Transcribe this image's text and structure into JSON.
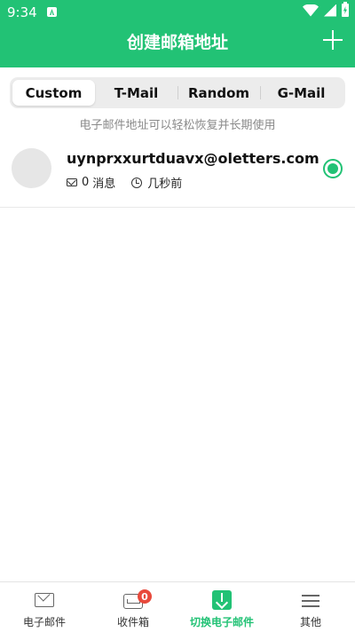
{
  "status_bar": {
    "time": "9:34"
  },
  "header": {
    "title": "创建邮箱地址"
  },
  "tabs": [
    {
      "label": "Custom",
      "active": true
    },
    {
      "label": "T-Mail",
      "active": false
    },
    {
      "label": "Random",
      "active": false
    },
    {
      "label": "G-Mail",
      "active": false
    }
  ],
  "hint": "电子邮件地址可以轻松恢复并长期使用",
  "email_entry": {
    "address": "uynprxxurtduavx@oletters.com",
    "message_count": "0",
    "message_unit": "消息",
    "time_ago": "几秒前",
    "selected": true
  },
  "bottom_nav": [
    {
      "label": "电子邮件",
      "icon": "mail-icon"
    },
    {
      "label": "收件箱",
      "icon": "inbox-icon",
      "badge": "0"
    },
    {
      "label": "切换电子邮件",
      "icon": "switch-email-icon",
      "active": true
    },
    {
      "label": "其他",
      "icon": "menu-icon"
    }
  ],
  "colors": {
    "accent": "#22c275",
    "badge": "#e84a3c"
  }
}
